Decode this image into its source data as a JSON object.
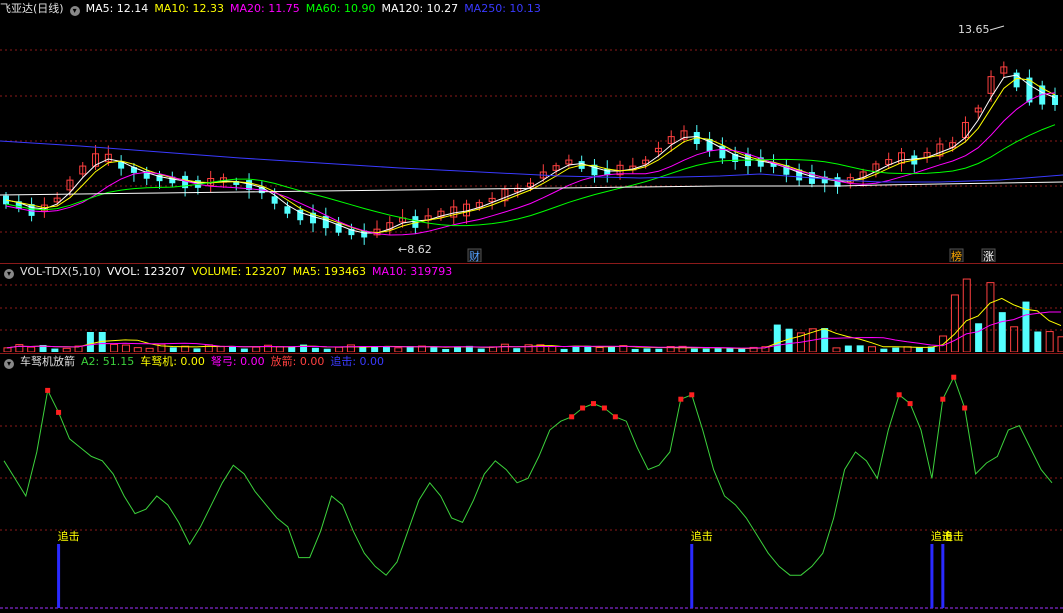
{
  "colors": {
    "ma5": "#ffffff",
    "ma10": "#ffff00",
    "ma20": "#ff00ff",
    "ma60": "#00ff00",
    "ma120": "#ffffff",
    "ma250": "#3a3aff",
    "up": "#ff4040",
    "down": "#54ffff",
    "osc": "#3cd23c",
    "signal": "#ff2020",
    "chase": "#2a2aff",
    "grid": "#8b1a1a"
  },
  "price_panel": {
    "title": "飞亚达(日线)",
    "indicators": [
      {
        "label": "MA5: 12.14",
        "color": "#ffffff"
      },
      {
        "label": "MA10: 12.33",
        "color": "#ffff00"
      },
      {
        "label": "MA20: 11.75",
        "color": "#ff00ff"
      },
      {
        "label": "MA60: 10.90",
        "color": "#00ff00"
      },
      {
        "label": "MA120: 10.27",
        "color": "#ffffff"
      },
      {
        "label": "MA250: 10.13",
        "color": "#3a3aff"
      }
    ],
    "high_label": "13.65",
    "low_label": "8.62",
    "badges": [
      "财",
      "榜",
      "涨"
    ]
  },
  "volume_panel": {
    "title": "VOL-TDX(5,10)",
    "indicators": [
      {
        "label": "VVOL: 123207",
        "color": "#ffffff"
      },
      {
        "label": "VOLUME: 123207",
        "color": "#ffff00"
      },
      {
        "label": "MA5: 193463",
        "color": "#ffff00"
      },
      {
        "label": "MA10: 319793",
        "color": "#ff00ff"
      }
    ]
  },
  "osc_panel": {
    "title": "车驽机放箭",
    "indicators": [
      {
        "label": "A2: 51.15",
        "color": "#3cd23c"
      },
      {
        "label": "车驽机: 0.00",
        "color": "#ffff00"
      },
      {
        "label": "弩弓: 0.00",
        "color": "#ff00ff"
      },
      {
        "label": "放箭: 0.00",
        "color": "#ff4040"
      },
      {
        "label": "追击: 0.00",
        "color": "#3a3aff"
      }
    ],
    "chase_label": "追击"
  },
  "chart_data": {
    "type": "line",
    "oscillator": [
      56,
      48,
      40,
      60,
      88,
      78,
      66,
      62,
      58,
      56,
      50,
      40,
      32,
      34,
      40,
      36,
      28,
      18,
      26,
      36,
      46,
      54,
      50,
      42,
      36,
      30,
      26,
      12,
      12,
      24,
      40,
      36,
      24,
      14,
      8,
      4,
      10,
      24,
      38,
      46,
      40,
      30,
      28,
      38,
      50,
      56,
      52,
      46,
      48,
      58,
      70,
      74,
      76,
      80,
      82,
      80,
      76,
      74,
      62,
      52,
      54,
      60,
      84,
      86,
      70,
      52,
      40,
      36,
      30,
      22,
      14,
      8,
      4,
      4,
      8,
      14,
      30,
      52,
      60,
      56,
      48,
      70,
      86,
      82,
      70,
      48,
      84,
      94,
      80,
      50,
      55,
      58,
      70,
      72,
      62,
      52,
      46
    ],
    "chase_signals": [
      5,
      63,
      85,
      86
    ]
  }
}
